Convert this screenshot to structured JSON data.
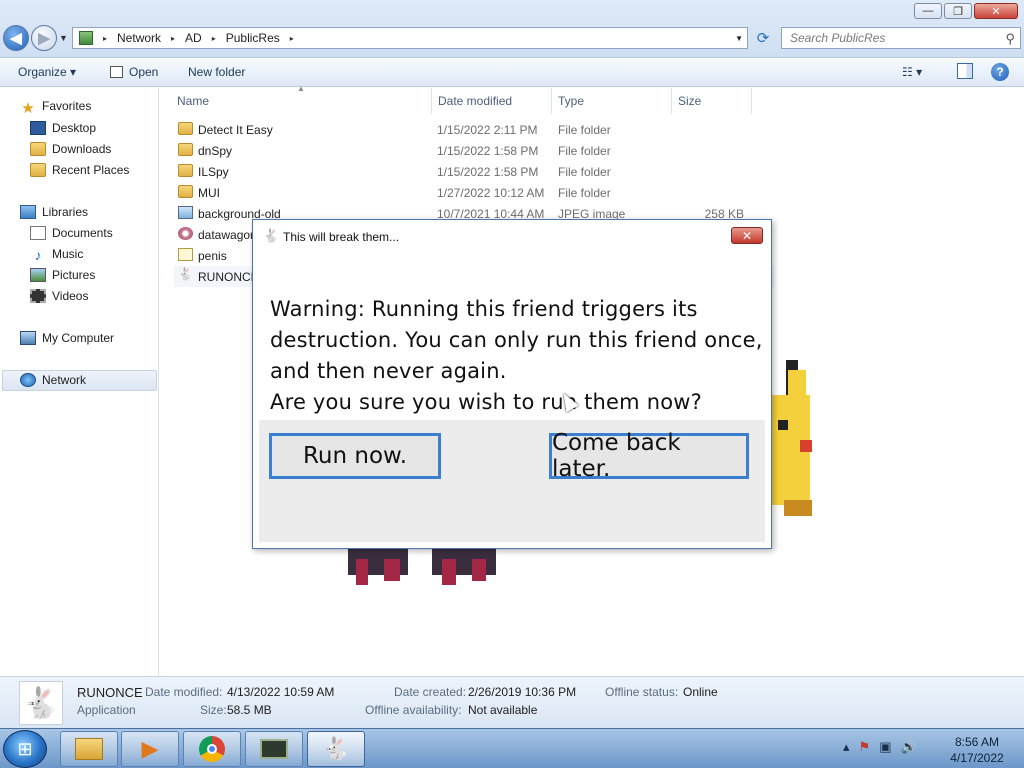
{
  "window": {
    "minimize_glyph": "—",
    "restore_glyph": "❐",
    "close_glyph": "✕"
  },
  "address": {
    "crumbs": [
      "Network",
      "AD",
      "PublicRes"
    ],
    "separator": "▸",
    "dropdown_glyph": "▼",
    "search_placeholder": "Search PublicRes"
  },
  "toolbar": {
    "organize_label": "Organize ▾",
    "open_label": "Open",
    "new_folder_label": "New folder",
    "view_glyph": "☷ ▾",
    "help_glyph": "?"
  },
  "sidebar": {
    "favorites": "Favorites",
    "desktop": "Desktop",
    "downloads": "Downloads",
    "recent_places": "Recent Places",
    "libraries": "Libraries",
    "documents": "Documents",
    "music": "Music",
    "pictures": "Pictures",
    "videos": "Videos",
    "my_computer": "My Computer",
    "network": "Network"
  },
  "columns": {
    "name": "Name",
    "date_modified": "Date modified",
    "type": "Type",
    "size": "Size"
  },
  "files": [
    {
      "name": "Detect It Easy",
      "date": "1/15/2022 2:11 PM",
      "type": "File folder",
      "size": "",
      "icon": "folder-icon"
    },
    {
      "name": "dnSpy",
      "date": "1/15/2022 1:58 PM",
      "type": "File folder",
      "size": "",
      "icon": "folder-icon"
    },
    {
      "name": "ILSpy",
      "date": "1/15/2022 1:58 PM",
      "type": "File folder",
      "size": "",
      "icon": "folder-icon"
    },
    {
      "name": "MUI",
      "date": "1/27/2022 10:12 AM",
      "type": "File folder",
      "size": "",
      "icon": "folder-icon"
    },
    {
      "name": "background-old",
      "date": "10/7/2021 10:44 AM",
      "type": "JPEG image",
      "size": "258 KB",
      "icon": "image-file-icon"
    },
    {
      "name": "datawagon",
      "date": "",
      "type": "",
      "size": "",
      "icon": "gear-file-icon"
    },
    {
      "name": "penis",
      "date": "",
      "type": "",
      "size": "",
      "icon": "script-file-icon"
    },
    {
      "name": "RUNONCE",
      "date": "",
      "type": "",
      "size": "",
      "icon": "bunny-app-icon"
    }
  ],
  "dialog": {
    "title": "This will break them...",
    "close_glyph": "✕",
    "message_lines": [
      "Warning: Running this friend triggers its",
      "destruction. You can only run this friend once,",
      "and then never again.",
      "Are you sure you wish to run them now?"
    ],
    "run_label": "Run now.",
    "later_label": "Come back later."
  },
  "details": {
    "name": "RUNONCE",
    "kind": "Application",
    "date_modified_label": "Date modified:",
    "date_modified": "4/13/2022 10:59 AM",
    "size_label": "Size:",
    "size": "58.5 MB",
    "date_created_label": "Date created:",
    "date_created": "2/26/2019 10:36 PM",
    "offline_availability_label": "Offline availability:",
    "offline_availability": "Not available",
    "offline_status_label": "Offline status:",
    "offline_status": "Online"
  },
  "taskbar": {
    "time": "8:56 AM",
    "date": "4/17/2022",
    "tray_glyphs": [
      "▴",
      "⚑",
      "▣",
      "🔊"
    ]
  },
  "colors": {
    "accent": "#3a7fd0",
    "close_red": "#c3382b"
  }
}
